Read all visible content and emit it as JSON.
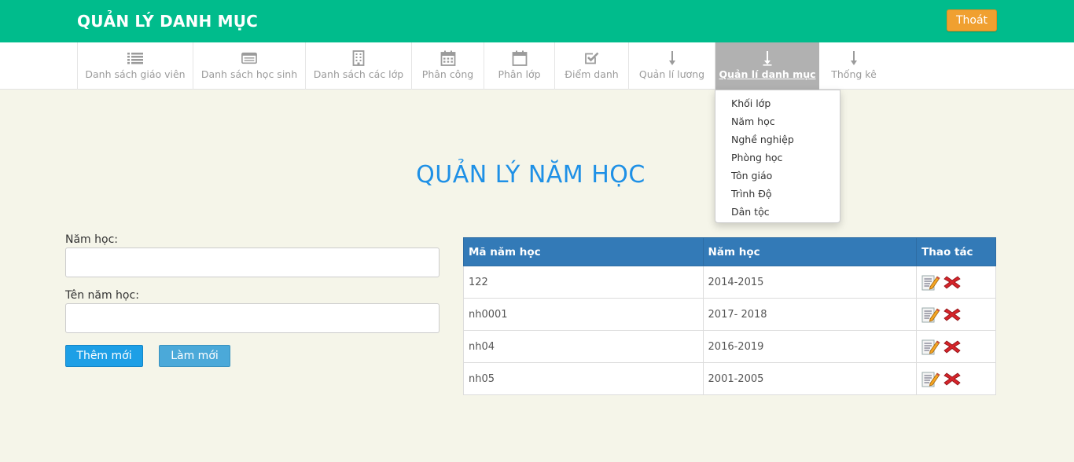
{
  "header": {
    "title": "QUẢN LÝ DANH MỤC",
    "logout_label": "Thoát",
    "bg_color": "#00bc8c"
  },
  "nav": {
    "items": [
      {
        "label": "Danh sách giáo viên",
        "icon": "list-icon"
      },
      {
        "label": "Danh sách học sinh",
        "icon": "id-card-icon"
      },
      {
        "label": "Danh sách các lớp",
        "icon": "building-icon"
      },
      {
        "label": "Phân công",
        "icon": "calendar-icon"
      },
      {
        "label": "Phân lớp",
        "icon": "calendar-blank-icon"
      },
      {
        "label": "Điểm danh",
        "icon": "check-square-icon"
      },
      {
        "label": "Quản lí lương",
        "icon": "arrow-down-icon"
      },
      {
        "label": "Quản lí danh mục",
        "icon": "arrow-down-icon",
        "active": true
      },
      {
        "label": "Thống kê",
        "icon": "arrow-down-icon"
      }
    ]
  },
  "dropdown": {
    "items": [
      "Khối lớp",
      "Năm học",
      "Nghề nghiệp",
      "Phòng học",
      "Tôn giáo",
      "Trình Độ",
      "Dân tộc"
    ]
  },
  "page": {
    "title": "QUẢN LÝ NĂM HỌC",
    "title_color": "#1e90e6"
  },
  "form": {
    "year_label": "Năm học:",
    "year_value": "",
    "name_label": "Tên năm học:",
    "name_value": "",
    "add_button": "Thêm mới",
    "reset_button": "Làm mới"
  },
  "table": {
    "headers": [
      "Mã năm học",
      "Năm học",
      "Thao tác"
    ],
    "header_color": "#337ab7",
    "rows": [
      {
        "code": "122",
        "year": "2014-2015"
      },
      {
        "code": "nh0001",
        "year": "2017- 2018"
      },
      {
        "code": "nh04",
        "year": "2016-2019"
      },
      {
        "code": "nh05",
        "year": "2001-2005"
      }
    ]
  }
}
